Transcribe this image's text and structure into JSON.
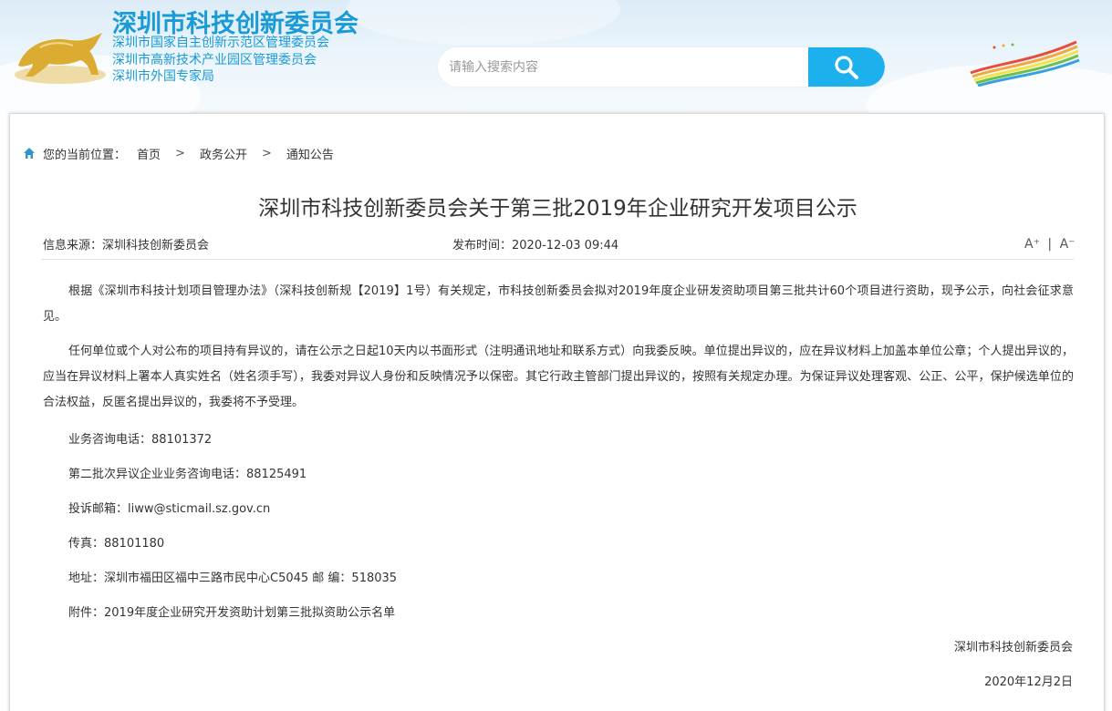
{
  "header": {
    "site_title": "深圳市科技创新委员会",
    "sub_titles": [
      "深圳市国家自主创新示范区管理委员会",
      "深圳市高新技术产业园区管理委员会",
      "深圳市外国专家局"
    ],
    "search_placeholder": "请输入搜索内容",
    "search_icon": "search-icon",
    "accent_color": "#1cb1ed"
  },
  "breadcrumb": {
    "label": "您的当前位置：",
    "items": [
      "首页",
      "政务公开",
      "通知公告"
    ],
    "separator": ">",
    "home_icon": "home-icon"
  },
  "article": {
    "title": "深圳市科技创新委员会关于第三批2019年企业研究开发项目公示",
    "source": "信息来源：深圳科技创新委员会",
    "published": "发布时间：2020-12-03 09:44",
    "font_increase": "A⁺",
    "font_divider": "|",
    "font_decrease": "A⁻",
    "paragraphs": [
      "根据《深圳市科技计划项目管理办法》（深科技创新规【2019】1号）有关规定，市科技创新委员会拟对2019年度企业研发资助项目第三批共计60个项目进行资助，现予公示，向社会征求意见。",
      "任何单位或个人对公布的项目持有异议的，请在公示之日起10天内以书面形式（注明通讯地址和联系方式）向我委反映。单位提出异议的，应在异议材料上加盖本单位公章；个人提出异议的，应当在异议材料上署本人真实姓名（姓名须手写），我委对异议人身份和反映情况予以保密。其它行政主管部门提出异议的，按照有关规定办理。为保证异议处理客观、公正、公平，保护候选单位的合法权益，反匿名提出异议的，我委将不予受理。"
    ],
    "contact_phone": "业务咨询电话：88101372",
    "second_batch_phone": "第二批次异议企业业务咨询电话：88125491",
    "complaint_email": "投诉邮箱：liww@sticmail.sz.gov.cn",
    "fax": "传真：88101180",
    "address": "地址：深圳市福田区福中三路市民中心C5045 邮 编：518035",
    "attachment": "附件：2019年度企业研究开发资助计划第三批拟资助公示名单",
    "signature": "深圳市科技创新委员会",
    "sign_date": "2020年12月2日"
  }
}
